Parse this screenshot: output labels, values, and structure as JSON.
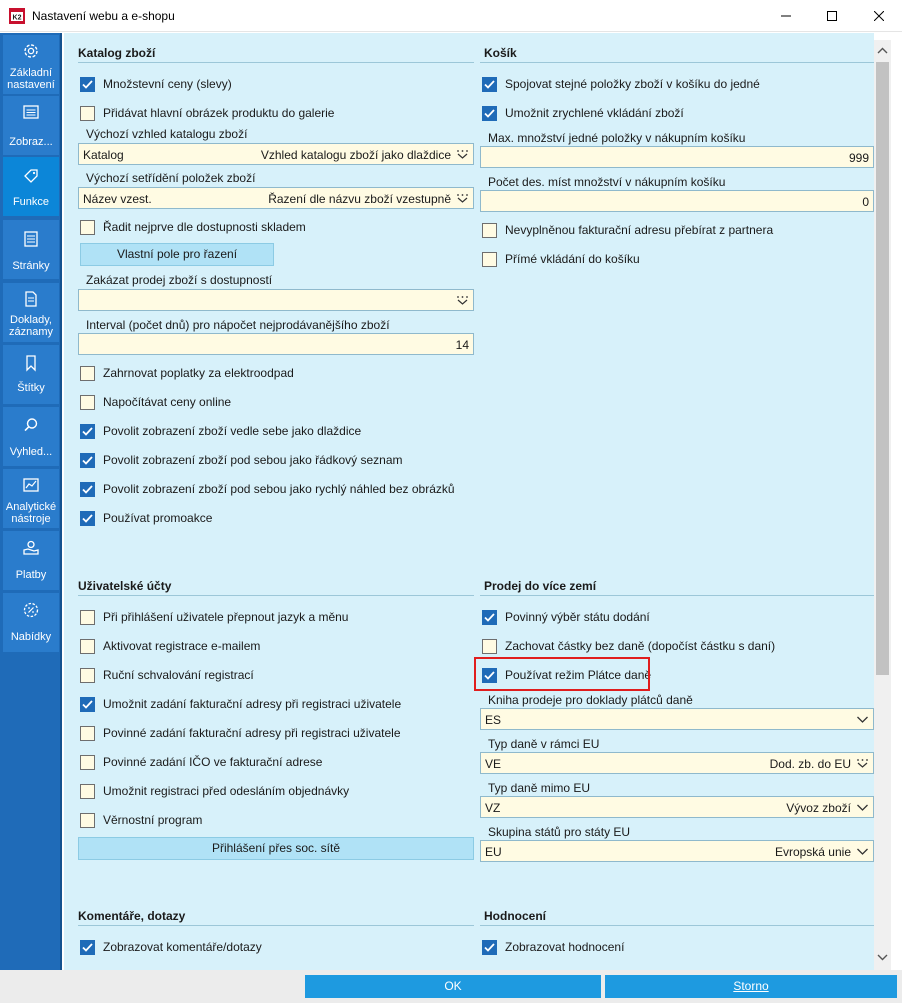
{
  "window": {
    "title": "Nastavení webu a e-shopu",
    "minimize_icon": "minimize-icon",
    "maximize_icon": "maximize-icon",
    "close_icon": "close-icon"
  },
  "sidebar": {
    "items": [
      {
        "label": "Základní nastavení",
        "icon": "gear-icon",
        "active": false
      },
      {
        "label": "Zobraz...",
        "icon": "display-icon",
        "active": false
      },
      {
        "label": "Funkce",
        "icon": "tag-icon",
        "active": true
      },
      {
        "label": "Stránky",
        "icon": "pages-icon",
        "active": false
      },
      {
        "label": "Doklady, záznamy",
        "icon": "document-icon",
        "active": false
      },
      {
        "label": "Štítky",
        "icon": "bookmark-icon",
        "active": false
      },
      {
        "label": "Vyhled...",
        "icon": "search-icon",
        "active": false
      },
      {
        "label": "Analytické nástroje",
        "icon": "chart-icon",
        "active": false
      },
      {
        "label": "Platby",
        "icon": "payment-icon",
        "active": false
      },
      {
        "label": "Nabídky",
        "icon": "offer-icon",
        "active": false
      }
    ]
  },
  "katalog": {
    "title": "Katalog zboží",
    "chk_mnozstevni": {
      "label": "Množstevní ceny (slevy)",
      "checked": true
    },
    "chk_obrazek": {
      "label": "Přidávat hlavní obrázek produktu do galerie",
      "checked": false
    },
    "vzhled_label": "Výchozí vzhled katalogu zboží",
    "vzhled_value": "Katalog",
    "vzhled_desc": "Vzhled katalogu zboží jako dlaždice",
    "setrideni_label": "Výchozí setřídění položek zboží",
    "setrideni_value": "Název vzest.",
    "setrideni_desc": "Řazení dle názvu zboží vzestupně",
    "chk_radit": {
      "label": "Řadit nejprve dle dostupnosti skladem",
      "checked": false
    },
    "btn_vlastni_pole": "Vlastní pole pro řazení",
    "zakazat_label": "Zakázat prodej zboží s dostupností",
    "zakazat_value": "",
    "interval_label": "Interval (počet dnů) pro nápočet nejprodávanějšího zboží",
    "interval_value": "14",
    "chk_elektro": {
      "label": "Zahrnovat poplatky za elektroodpad",
      "checked": false
    },
    "chk_online": {
      "label": "Napočítávat ceny online",
      "checked": false
    },
    "chk_dlazdice": {
      "label": "Povolit zobrazení zboží vedle sebe jako dlaždice",
      "checked": true
    },
    "chk_seznam": {
      "label": "Povolit zobrazení zboží pod sebou jako řádkový seznam",
      "checked": true
    },
    "chk_nahled": {
      "label": "Povolit zobrazení zboží pod sebou jako rychlý náhled bez obrázků",
      "checked": true
    },
    "chk_promo": {
      "label": "Používat promoakce",
      "checked": true
    }
  },
  "kosik": {
    "title": "Košík",
    "chk_spojovat": {
      "label": "Spojovat stejné položky zboží v košíku do jedné",
      "checked": true
    },
    "chk_zrychlene": {
      "label": "Umožnit zrychlené vkládání zboží",
      "checked": true
    },
    "max_label": "Max. množství jedné položky v nákupním košíku",
    "max_value": "999",
    "des_label": "Počet des. míst množství v nákupním košíku",
    "des_value": "0",
    "chk_adresa": {
      "label": "Nevyplněnou fakturační adresu přebírat z partnera",
      "checked": false
    },
    "chk_prime": {
      "label": "Přímé vkládání do košíku",
      "checked": false
    }
  },
  "ucty": {
    "title": "Uživatelské účty",
    "chk_jazyk": {
      "label": "Při přihlášení uživatele přepnout jazyk a měnu",
      "checked": false
    },
    "chk_email": {
      "label": "Aktivovat registrace e-mailem",
      "checked": false
    },
    "chk_rucni": {
      "label": "Ruční schvalování registrací",
      "checked": false
    },
    "chk_fa_umoznit": {
      "label": "Umožnit zadání fakturační adresy při registraci uživatele",
      "checked": true
    },
    "chk_fa_povinne": {
      "label": "Povinné zadání fakturační adresy při registraci uživatele",
      "checked": false
    },
    "chk_ico": {
      "label": "Povinné zadání IČO ve fakturační adrese",
      "checked": false
    },
    "chk_pred_odeslanim": {
      "label": "Umožnit registraci před odesláním objednávky",
      "checked": false
    },
    "chk_vernost": {
      "label": "Věrnostní program",
      "checked": false
    },
    "btn_soc": "Přihlášení přes soc. sítě"
  },
  "prodej": {
    "title": "Prodej do více zemí",
    "chk_povinny": {
      "label": "Povinný výběr státu dodání",
      "checked": true
    },
    "chk_zachovat": {
      "label": "Zachovat částky bez daně (dopočíst částku s daní)",
      "checked": false
    },
    "chk_platce": {
      "label": "Používat režim Plátce daně",
      "checked": true
    },
    "kniha_label": "Kniha prodeje pro doklady plátců daně",
    "kniha_value": "ES",
    "typ_eu_label": "Typ daně v rámci EU",
    "typ_eu_value": "VE",
    "typ_eu_desc": "Dod. zb. do EU",
    "typ_mimo_label": "Typ daně mimo EU",
    "typ_mimo_value": "VZ",
    "typ_mimo_desc": "Vývoz zboží",
    "skupina_label": "Skupina států pro státy EU",
    "skupina_value": "EU",
    "skupina_desc": "Evropská unie"
  },
  "komentare": {
    "title": "Komentáře, dotazy",
    "chk_zobrazovat": {
      "label": "Zobrazovat komentáře/dotazy",
      "checked": true
    }
  },
  "hodnoceni": {
    "title": "Hodnocení",
    "chk_zobrazovat": {
      "label": "Zobrazovat hodnocení",
      "checked": true
    }
  },
  "footer": {
    "ok_label": "OK",
    "storno_label": "Storno"
  },
  "colors": {
    "sidebar": "#1f6bb8",
    "sidebar_active": "#0c86d8",
    "content_bg": "#d7f1fa",
    "field_bg": "#fffbe3",
    "button_light": "#b0e2f6",
    "button_footer": "#1e9ae0",
    "highlight": "#e01e1e"
  }
}
